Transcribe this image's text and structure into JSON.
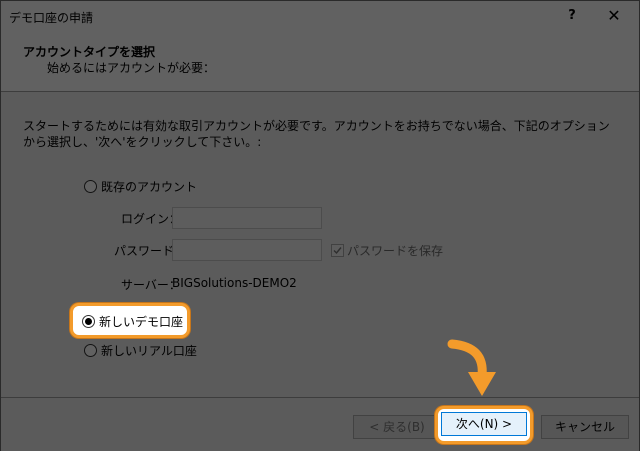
{
  "window": {
    "title": "デモ口座の申請",
    "help_label": "?",
    "close_label": "✕"
  },
  "header": {
    "title": "アカウントタイプを選択",
    "subtitle": "始めるにはアカウントが必要："
  },
  "description": "スタートするためには有効な取引アカウントが必要です。アカウントをお持ちでない場合、下記のオプションから選択し、'次へ'をクリックして下さい。:",
  "options": {
    "existing": {
      "label": "既存のアカウント",
      "selected": false
    },
    "new_demo": {
      "label": "新しいデモ口座",
      "selected": true
    },
    "new_real": {
      "label": "新しいリアル口座",
      "selected": false
    }
  },
  "fields": {
    "login_label": "ログイン：",
    "login_value": "",
    "password_label": "パスワード：",
    "password_value": "",
    "save_password_label": "パスワードを保存",
    "save_password_checked": true,
    "server_label": "サーバー：",
    "server_value": "BIGSolutions-DEMO2"
  },
  "buttons": {
    "back": "< 戻る(B)",
    "next": "次へ(N) >",
    "cancel": "キャンセル"
  },
  "colors": {
    "highlight": "#f39b2b",
    "arrow": "#f39b2b",
    "overlay": "#000000"
  }
}
